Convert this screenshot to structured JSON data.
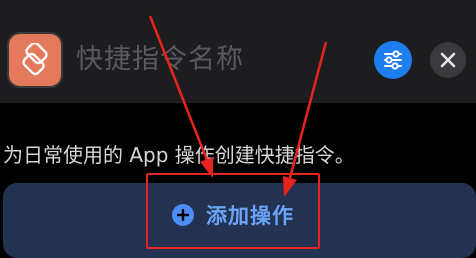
{
  "header": {
    "shortcut_name": "快捷指令名称",
    "app_icon": "shortcuts-layers-icon",
    "settings_icon": "sliders-icon",
    "close_icon": "close-icon"
  },
  "main": {
    "description": "为日常使用的 App 操作创建快捷指令。",
    "add_action": {
      "label": "添加操作",
      "icon": "plus-circle-icon"
    }
  },
  "annotation": {
    "color": "#e8241e"
  },
  "colors": {
    "background": "#000000",
    "header": "#1d1d1f",
    "app_icon": "#e47a5b",
    "accent": "#1e7ef0",
    "button_bg": "#233250",
    "button_text": "#6aa3f8"
  }
}
